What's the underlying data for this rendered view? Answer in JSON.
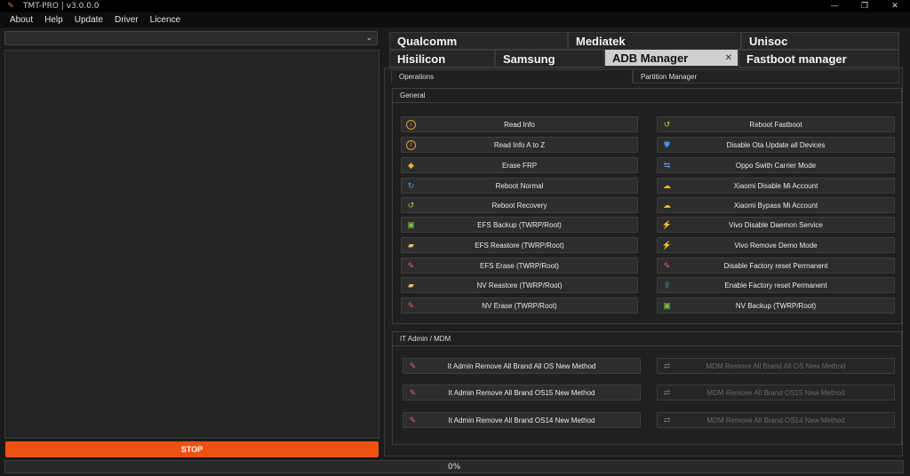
{
  "window": {
    "title": "TMT-PRO | v3.0.0.0",
    "controls": [
      "—",
      "❐",
      "✕"
    ]
  },
  "menu": [
    "About",
    "Help",
    "Update",
    "Driver",
    "Licence"
  ],
  "top_tabs_row1": [
    {
      "label": "Qualcomm"
    },
    {
      "label": "Mediatek"
    },
    {
      "label": "Unisoc"
    }
  ],
  "top_tabs_row2": [
    {
      "label": "Hisilicon"
    },
    {
      "label": "Samsung"
    },
    {
      "label": "ADB Manager",
      "active": true
    },
    {
      "label": "Fastboot manager"
    }
  ],
  "sub_tabs": [
    {
      "label": "Operations",
      "active": true
    },
    {
      "label": "Partition Manager"
    }
  ],
  "general": {
    "title": "General",
    "left": [
      {
        "label": "Read Info",
        "icon": "info-icon"
      },
      {
        "label": "Read Info A to Z",
        "icon": "info-icon"
      },
      {
        "label": "Erase FRP",
        "icon": "eraser-icon"
      },
      {
        "label": "Reboot Normal",
        "icon": "refresh-icon"
      },
      {
        "label": "Reboot Recovery",
        "icon": "recovery-icon"
      },
      {
        "label": "EFS Backup (TWRP/Root)",
        "icon": "backup-icon"
      },
      {
        "label": "EFS Reastore (TWRP/Root)",
        "icon": "folder-icon"
      },
      {
        "label": "EFS Erase (TWRP/Root)",
        "icon": "pencil-eraser-icon"
      },
      {
        "label": "NV Reastore (TWRP/Root)",
        "icon": "folder-icon"
      },
      {
        "label": "NV Erase (TWRP/Root)",
        "icon": "pencil-eraser-icon"
      }
    ],
    "right": [
      {
        "label": "Reboot Fastboot",
        "icon": "recovery-icon"
      },
      {
        "label": "Disable Ota Update all Devices",
        "icon": "shield-icon"
      },
      {
        "label": "Oppo Swith Carrier Mode",
        "icon": "switch-icon"
      },
      {
        "label": "Xiaomi Disable Mi Account",
        "icon": "cloud-icon"
      },
      {
        "label": "Xiaomi Bypass Mi Account",
        "icon": "cloud-icon"
      },
      {
        "label": "Vivo Disable Daemon Service",
        "icon": "lightning-icon"
      },
      {
        "label": "Vivo Remove Demo Mode",
        "icon": "lightning-icon"
      },
      {
        "label": "Disable Factory reset  Permanent",
        "icon": "pencil-eraser-icon"
      },
      {
        "label": "Enable  Factory reset  Permanent",
        "icon": "upload-icon"
      },
      {
        "label": "NV Backup (TWRP/Root)",
        "icon": "backup-icon"
      }
    ]
  },
  "mdm": {
    "title": "IT Admin / MDM",
    "left": [
      {
        "label": "It Admin Remove All Brand All OS New Method"
      },
      {
        "label": "It Admin Remove All Brand  OS15 New Method"
      },
      {
        "label": "It Admin Remove All Brand  OS14 New Method"
      }
    ],
    "right": [
      {
        "label": "MDM Remove All Brand All OS New Method"
      },
      {
        "label": "MDM Remove All Brand  OS15 New Method"
      },
      {
        "label": "MDM Remove All Brand  OS14 New Method"
      }
    ]
  },
  "stop_label": "STOP",
  "progress": {
    "text": "0%",
    "value": 0
  },
  "colors": {
    "accent": "#ee5213",
    "active_tab": "#cfcfcf",
    "info": "#e0a020"
  }
}
